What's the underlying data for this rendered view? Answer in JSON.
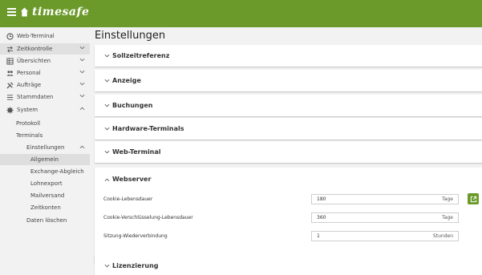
{
  "app": {
    "brand": "timesafe"
  },
  "sidebar": {
    "items": [
      {
        "label": "Web-Terminal",
        "icon": "clock-icon"
      },
      {
        "label": "Zeitkontrolle",
        "icon": "swap-icon"
      },
      {
        "label": "Übersichten",
        "icon": "table-icon"
      },
      {
        "label": "Personal",
        "icon": "people-icon"
      },
      {
        "label": "Aufträge",
        "icon": "tools-icon"
      },
      {
        "label": "Stammdaten",
        "icon": "list-icon"
      },
      {
        "label": "System",
        "icon": "gear-icon"
      }
    ],
    "system_children": [
      "Protokoll",
      "Terminals",
      "Einstellungen"
    ],
    "einstellungen_children": [
      "Allgemein",
      "Exchange-Abgleich",
      "Lohnexport",
      "Mailversand",
      "Zeitkonten"
    ],
    "daten_loeschen": "Daten löschen"
  },
  "main": {
    "title": "Einstellungen",
    "sections": [
      "Sollzeitreferenz",
      "Anzeige",
      "Buchungen",
      "Hardware-Terminals",
      "Web-Terminal"
    ],
    "webserver": {
      "title": "Webserver",
      "rows": [
        {
          "label": "Cookie-Lebensdauer",
          "value": "180",
          "unit": "Tage"
        },
        {
          "label": "Cookie-Verschlüsselung-Lebensdauer",
          "value": "360",
          "unit": "Tage"
        },
        {
          "label": "Sitzung-Wiederverbindung",
          "value": "1",
          "unit": "Stunden"
        }
      ]
    },
    "lizenzierung": "Lizenzierung"
  },
  "colors": {
    "brand_green": "#6b9a2a",
    "background": "#f2f2f2"
  }
}
